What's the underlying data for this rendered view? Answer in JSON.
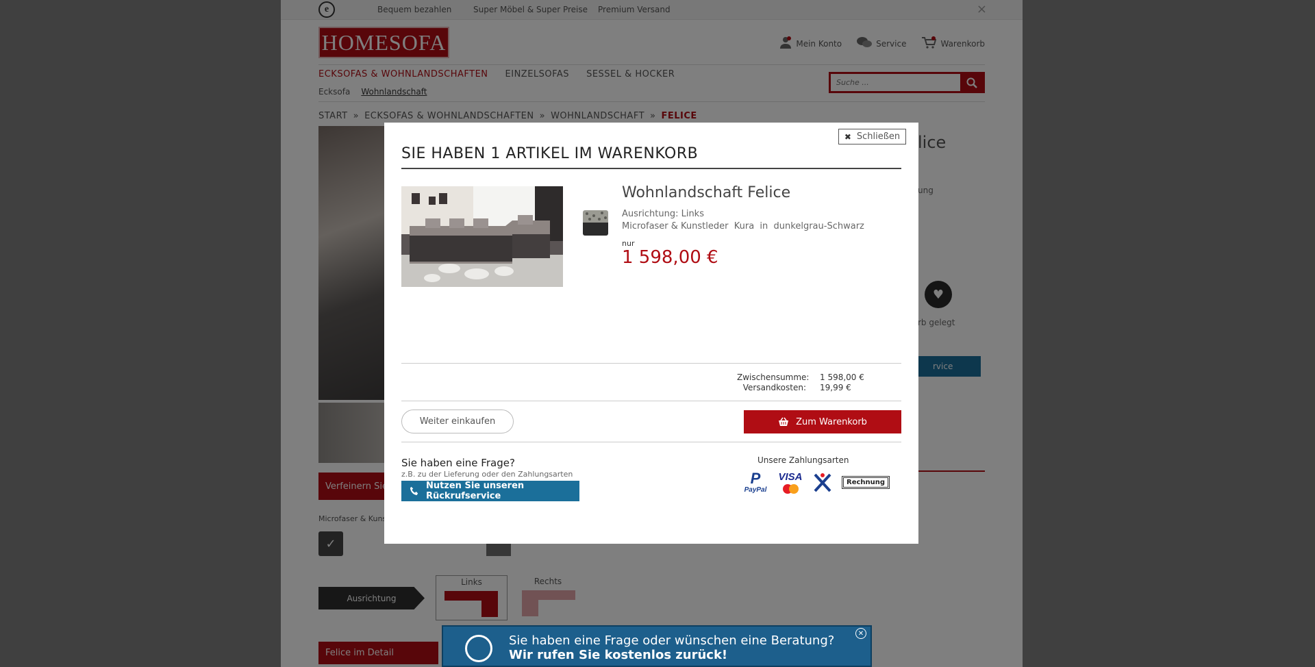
{
  "topbar": {
    "items": [
      "Bequem bezahlen",
      "Super Möbel & Super Preise",
      "Premium Versand"
    ]
  },
  "header": {
    "logo_text": "HOMESOFA",
    "my_account": "Mein Konto",
    "service": "Service",
    "cart": "Warenkorb"
  },
  "nav": {
    "main": [
      "ECKSOFAS & WOHNLANDSCHAFTEN",
      "EINZELSOFAS",
      "SESSEL & HOCKER"
    ],
    "sub": [
      "Ecksofa",
      "Wohnlandschaft"
    ],
    "search_placeholder": "Suche ..."
  },
  "breadcrumb": [
    "START",
    "ECKSOFAS & WOHNLANDSCHAFTEN",
    "WOHNLANDSCHAFT",
    "FELICE"
  ],
  "background": {
    "title_fragment": "lice",
    "text_fragment": "ung",
    "added_fragment": "rb gelegt",
    "service_fragment": "rvice",
    "refine_label": "Verfeinern Sie",
    "material_fragment": "Microfaser & Kuns",
    "orientation_label": "Ausrichtung",
    "option_left": "Links",
    "option_right": "Rechts",
    "detail_label": "Felice im Detail"
  },
  "callback_banner": {
    "line1": "Sie haben eine Frage oder wünschen eine Beratung?",
    "line2": "Wir rufen Sie kostenlos zurück!"
  },
  "modal": {
    "close_label": "Schließen",
    "title": "SIE HABEN 1 ARTIKEL IM WARENKORB",
    "product": {
      "name": "Wohnlandschaft Felice",
      "orientation": "Ausrichtung: Links",
      "material": "Microfaser & Kunstleder  Kura  in  dunkelgrau-Schwarz",
      "price_prefix": "nur",
      "price": "1 598,00 €"
    },
    "totals": {
      "subtotal_label": "Zwischensumme:",
      "subtotal_value": "1 598,00 €",
      "shipping_label": "Versandkosten:",
      "shipping_value": "19,99 €"
    },
    "continue_label": "Weiter einkaufen",
    "to_cart_label": "Zum Warenkorb",
    "faq_title": "Sie haben eine Frage?",
    "faq_sub": "z.B. zu der Lieferung oder den Zahlungsarten",
    "callback_button": "Nutzen Sie unseren Rückrufservice",
    "payment_title": "Unsere Zahlungsarten",
    "payment": {
      "paypal_glyph": "P",
      "paypal_name": "PayPal",
      "visa_name": "VISA",
      "invoice_name": "Rechnung"
    }
  },
  "colors": {
    "brand_red": "#b00d14",
    "service_blue": "#1b6f9a",
    "banner_blue": "#1d5f8c"
  },
  "icons": {
    "cart": "cart-icon",
    "account": "user-icon",
    "service": "chat-icon",
    "search": "search-icon",
    "close": "close-icon",
    "phone": "phone-icon",
    "heart": "heart-icon"
  }
}
